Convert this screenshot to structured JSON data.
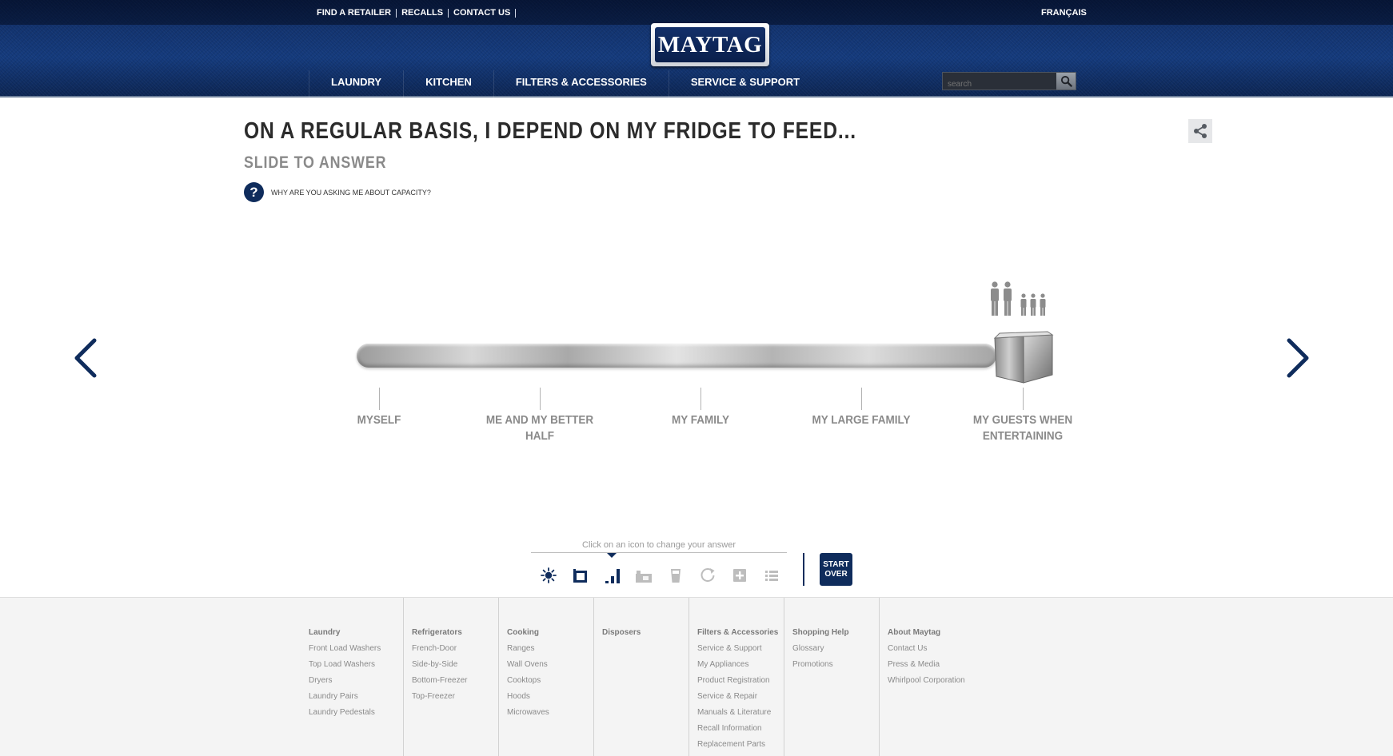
{
  "header": {
    "top_links": [
      "FIND A RETAILER",
      "RECALLS",
      "CONTACT US"
    ],
    "language_link": "FRANÇAIS",
    "logo_text": "MAYTAG",
    "nav": [
      "LAUNDRY",
      "KITCHEN",
      "FILTERS & ACCESSORIES",
      "SERVICE & SUPPORT"
    ],
    "search_placeholder": "search"
  },
  "question": {
    "title": "ON A REGULAR BASIS, I DEPEND ON MY FRIDGE TO FEED...",
    "subtitle": "SLIDE TO ANSWER",
    "help_glyph": "?",
    "help_text": "WHY ARE YOU ASKING ME ABOUT CAPACITY?"
  },
  "slider": {
    "options": [
      "MYSELF",
      "ME AND MY BETTER HALF",
      "MY FAMILY",
      "MY LARGE FAMILY",
      "MY GUESTS WHEN ENTERTAINING"
    ],
    "selected_index": 4,
    "selected_fraction": 1.0
  },
  "step_nav": {
    "caption": "Click on an icon to change your answer",
    "icons": [
      "sun-icon",
      "fridge-icon",
      "bar-chart-icon",
      "kitchen-icon",
      "cup-icon",
      "refresh-icon",
      "plus-box-icon",
      "list-icon"
    ],
    "active_index": 2,
    "start_over_line1": "START",
    "start_over_line2": "OVER"
  },
  "footer": {
    "columns": [
      {
        "heading": "Laundry",
        "links": [
          "Front Load Washers",
          "Top Load Washers",
          "Dryers",
          "Laundry Pairs",
          "Laundry Pedestals"
        ]
      },
      {
        "heading": "Refrigerators",
        "links": [
          "French-Door",
          "Side-by-Side",
          "Bottom-Freezer",
          "Top-Freezer"
        ]
      },
      {
        "heading": "Cooking",
        "links": [
          "Ranges",
          "Wall Ovens",
          "Cooktops",
          "Hoods",
          "Microwaves"
        ]
      },
      {
        "heading": "Disposers",
        "links": []
      },
      {
        "heading": "Filters & Accessories",
        "links": [
          "Service & Support",
          "My Appliances",
          "Product Registration",
          "Service & Repair",
          "Manuals & Literature",
          "Recall Information",
          "Replacement Parts"
        ]
      },
      {
        "heading": "Shopping Help",
        "links": [
          "Glossary",
          "Promotions"
        ]
      },
      {
        "heading": "About Maytag",
        "links": [
          "Contact Us",
          "Press & Media",
          "Whirlpool Corporation"
        ]
      }
    ]
  },
  "colors": {
    "brand_navy": "#0f2c5c",
    "header_blue": "#143a7c",
    "slider_label_gray": "#8a8a8a",
    "footer_bg": "#f4f4f4"
  }
}
